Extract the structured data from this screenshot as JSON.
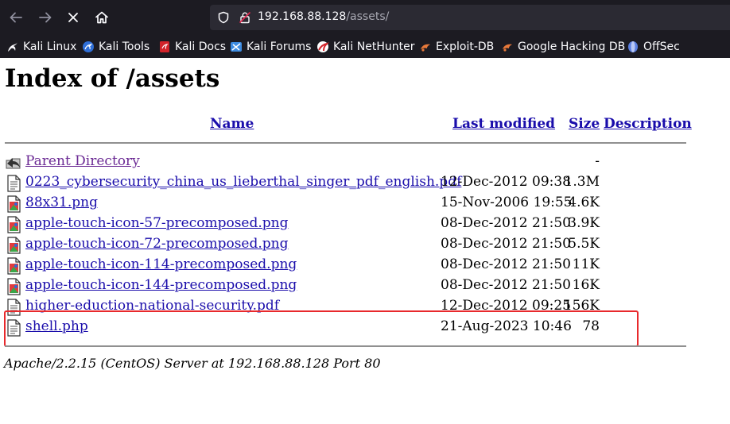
{
  "browser": {
    "url_host": "192.168.88.128",
    "url_path": "/assets/"
  },
  "bookmarks": [
    {
      "label": "Kali Linux",
      "icon": "kali-dragon-icon"
    },
    {
      "label": "Kali Tools",
      "icon": "kali-tools-icon"
    },
    {
      "label": "Kali Docs",
      "icon": "kali-docs-icon"
    },
    {
      "label": "Kali Forums",
      "icon": "kali-forums-icon"
    },
    {
      "label": "Kali NetHunter",
      "icon": "kali-nethunter-icon"
    },
    {
      "label": "Exploit-DB",
      "icon": "exploit-db-icon"
    },
    {
      "label": "Google Hacking DB",
      "icon": "ghdb-icon"
    },
    {
      "label": "OffSec",
      "icon": "offsec-icon"
    }
  ],
  "page": {
    "title": "Index of /assets",
    "columns": {
      "name": "Name",
      "last_modified": "Last modified",
      "size": "Size",
      "description": "Description"
    },
    "rows": [
      {
        "name": "Parent Directory",
        "date": "",
        "size": "-",
        "icon": "back-folder-icon"
      },
      {
        "name": "0223_cybersecurity_china_us_lieberthal_singer_pdf_english.pdf",
        "date": "12-Dec-2012 09:38",
        "size": "1.3M",
        "icon": "document-file-icon"
      },
      {
        "name": "88x31.png",
        "date": "15-Nov-2006 19:55",
        "size": "4.6K",
        "icon": "image-file-icon"
      },
      {
        "name": "apple-touch-icon-57-precomposed.png",
        "date": "08-Dec-2012 21:50",
        "size": "3.9K",
        "icon": "image-file-icon"
      },
      {
        "name": "apple-touch-icon-72-precomposed.png",
        "date": "08-Dec-2012 21:50",
        "size": "5.5K",
        "icon": "image-file-icon"
      },
      {
        "name": "apple-touch-icon-114-precomposed.png",
        "date": "08-Dec-2012 21:50",
        "size": "11K",
        "icon": "image-file-icon"
      },
      {
        "name": "apple-touch-icon-144-precomposed.png",
        "date": "08-Dec-2012 21:50",
        "size": "16K",
        "icon": "image-file-icon"
      },
      {
        "name": "higher-eduction-national-security.pdf",
        "date": "12-Dec-2012 09:25",
        "size": "156K",
        "icon": "document-file-icon"
      },
      {
        "name": "shell.php",
        "date": "21-Aug-2023 10:46",
        "size": "78",
        "icon": "document-file-icon"
      }
    ],
    "footer": "Apache/2.2.15 (CentOS) Server at 192.168.88.128 Port 80"
  },
  "colors": {
    "link": "#1a0dab",
    "visited_link": "#6b2a94",
    "highlight_box": "#e8292c",
    "chrome_bg": "#1c1b22"
  }
}
